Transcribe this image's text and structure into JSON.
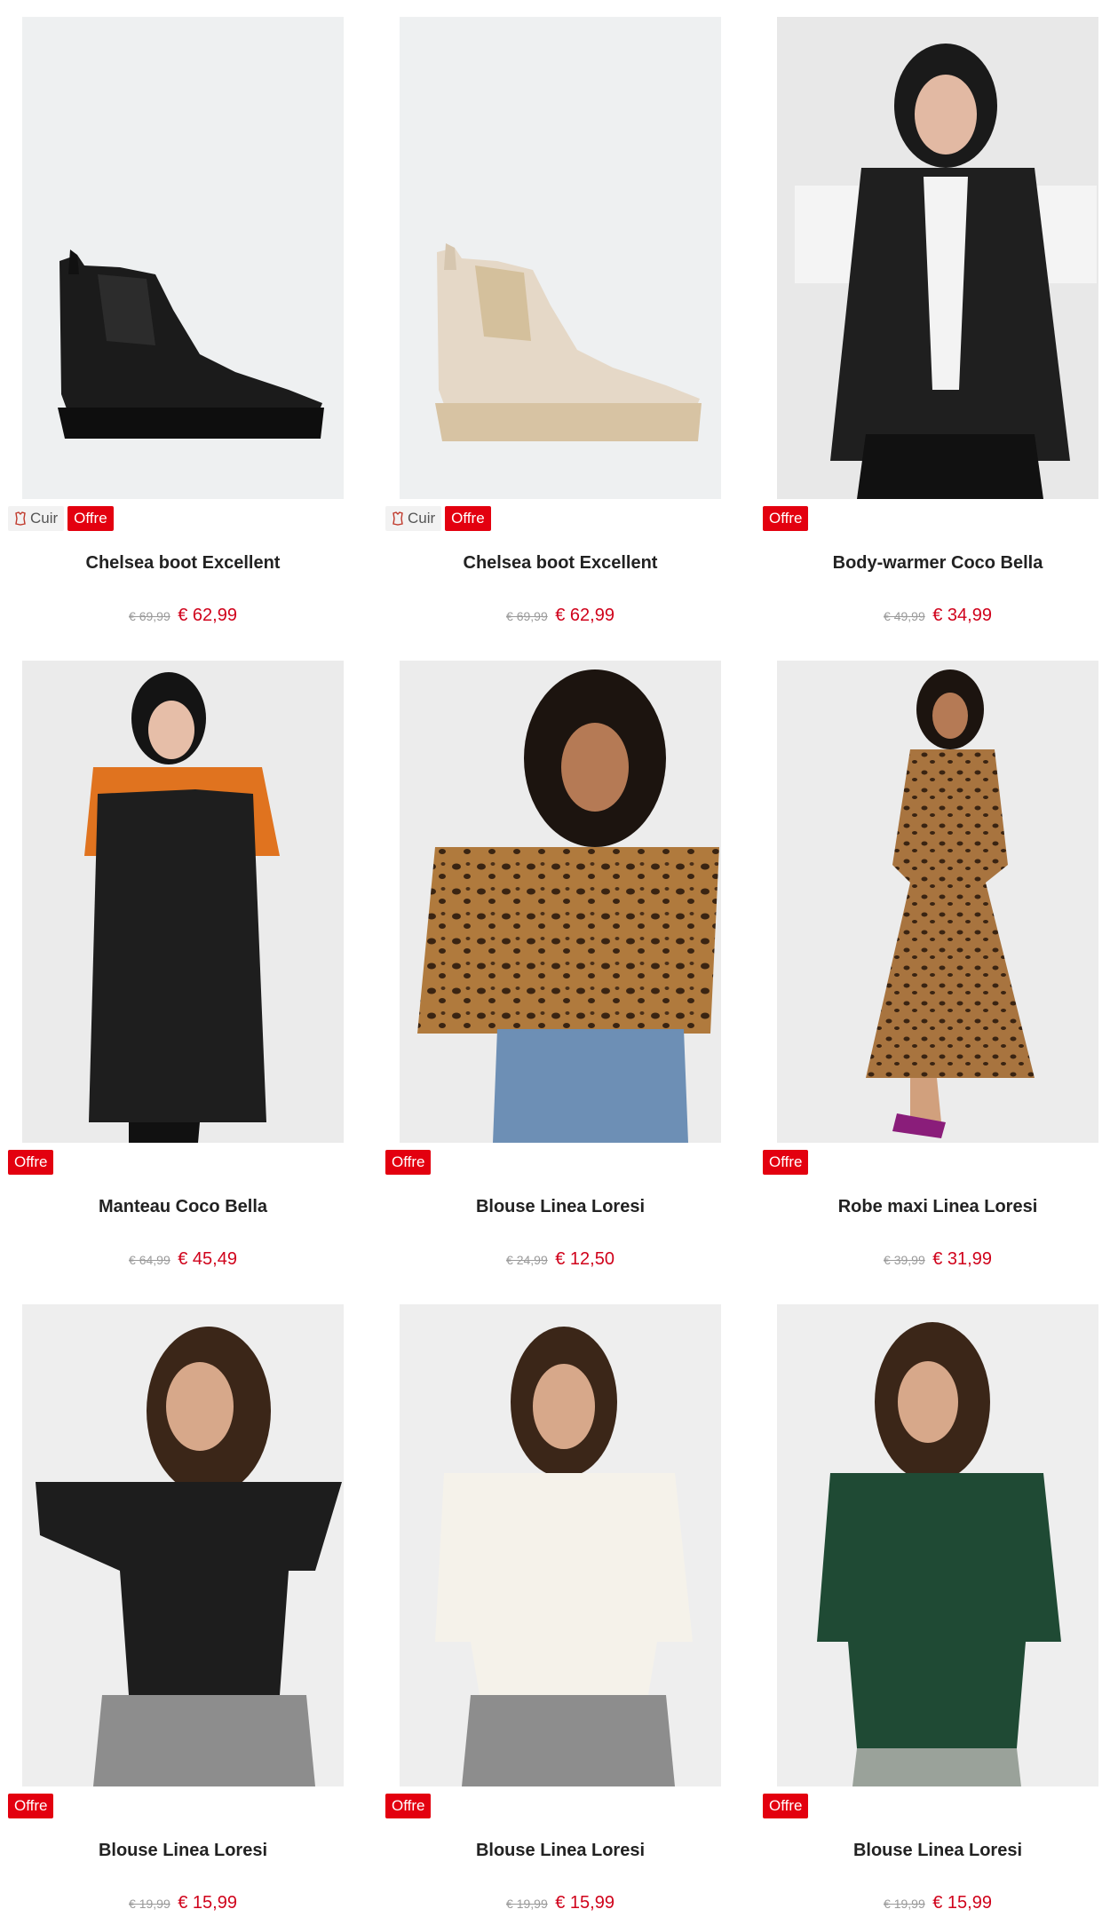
{
  "colors": {
    "offer": "#e3000f",
    "price": "#d0021b"
  },
  "products": [
    {
      "name": "Chelsea boot Excellent",
      "material_badge": "Cuir",
      "offer_badge": "Offre",
      "old_price": "€ 69,99",
      "price": "€ 62,99",
      "image": "black-chelsea-boot",
      "material_icon": "leather-icon"
    },
    {
      "name": "Chelsea boot Excellent",
      "material_badge": "Cuir",
      "offer_badge": "Offre",
      "old_price": "€ 69,99",
      "price": "€ 62,99",
      "image": "beige-chelsea-boot",
      "material_icon": "leather-icon"
    },
    {
      "name": "Body-warmer Coco Bella",
      "offer_badge": "Offre",
      "old_price": "€ 49,99",
      "price": "€ 34,99",
      "image": "black-bodywarmer-model"
    },
    {
      "name": "Manteau Coco Bella",
      "offer_badge": "Offre",
      "old_price": "€ 64,99",
      "price": "€ 45,49",
      "image": "long-black-coat-model"
    },
    {
      "name": "Blouse Linea Loresi",
      "offer_badge": "Offre",
      "old_price": "€ 24,99",
      "price": "€ 12,50",
      "image": "leopard-blouse-model"
    },
    {
      "name": "Robe maxi Linea Loresi",
      "offer_badge": "Offre",
      "old_price": "€ 39,99",
      "price": "€ 31,99",
      "image": "leopard-maxi-dress-model"
    },
    {
      "name": "Blouse Linea Loresi",
      "offer_badge": "Offre",
      "old_price": "€ 19,99",
      "price": "€ 15,99",
      "image": "black-ribbed-top-model"
    },
    {
      "name": "Blouse Linea Loresi",
      "offer_badge": "Offre",
      "old_price": "€ 19,99",
      "price": "€ 15,99",
      "image": "white-ribbed-top-model"
    },
    {
      "name": "Blouse Linea Loresi",
      "offer_badge": "Offre",
      "old_price": "€ 19,99",
      "price": "€ 15,99",
      "image": "green-ribbed-top-model"
    }
  ]
}
